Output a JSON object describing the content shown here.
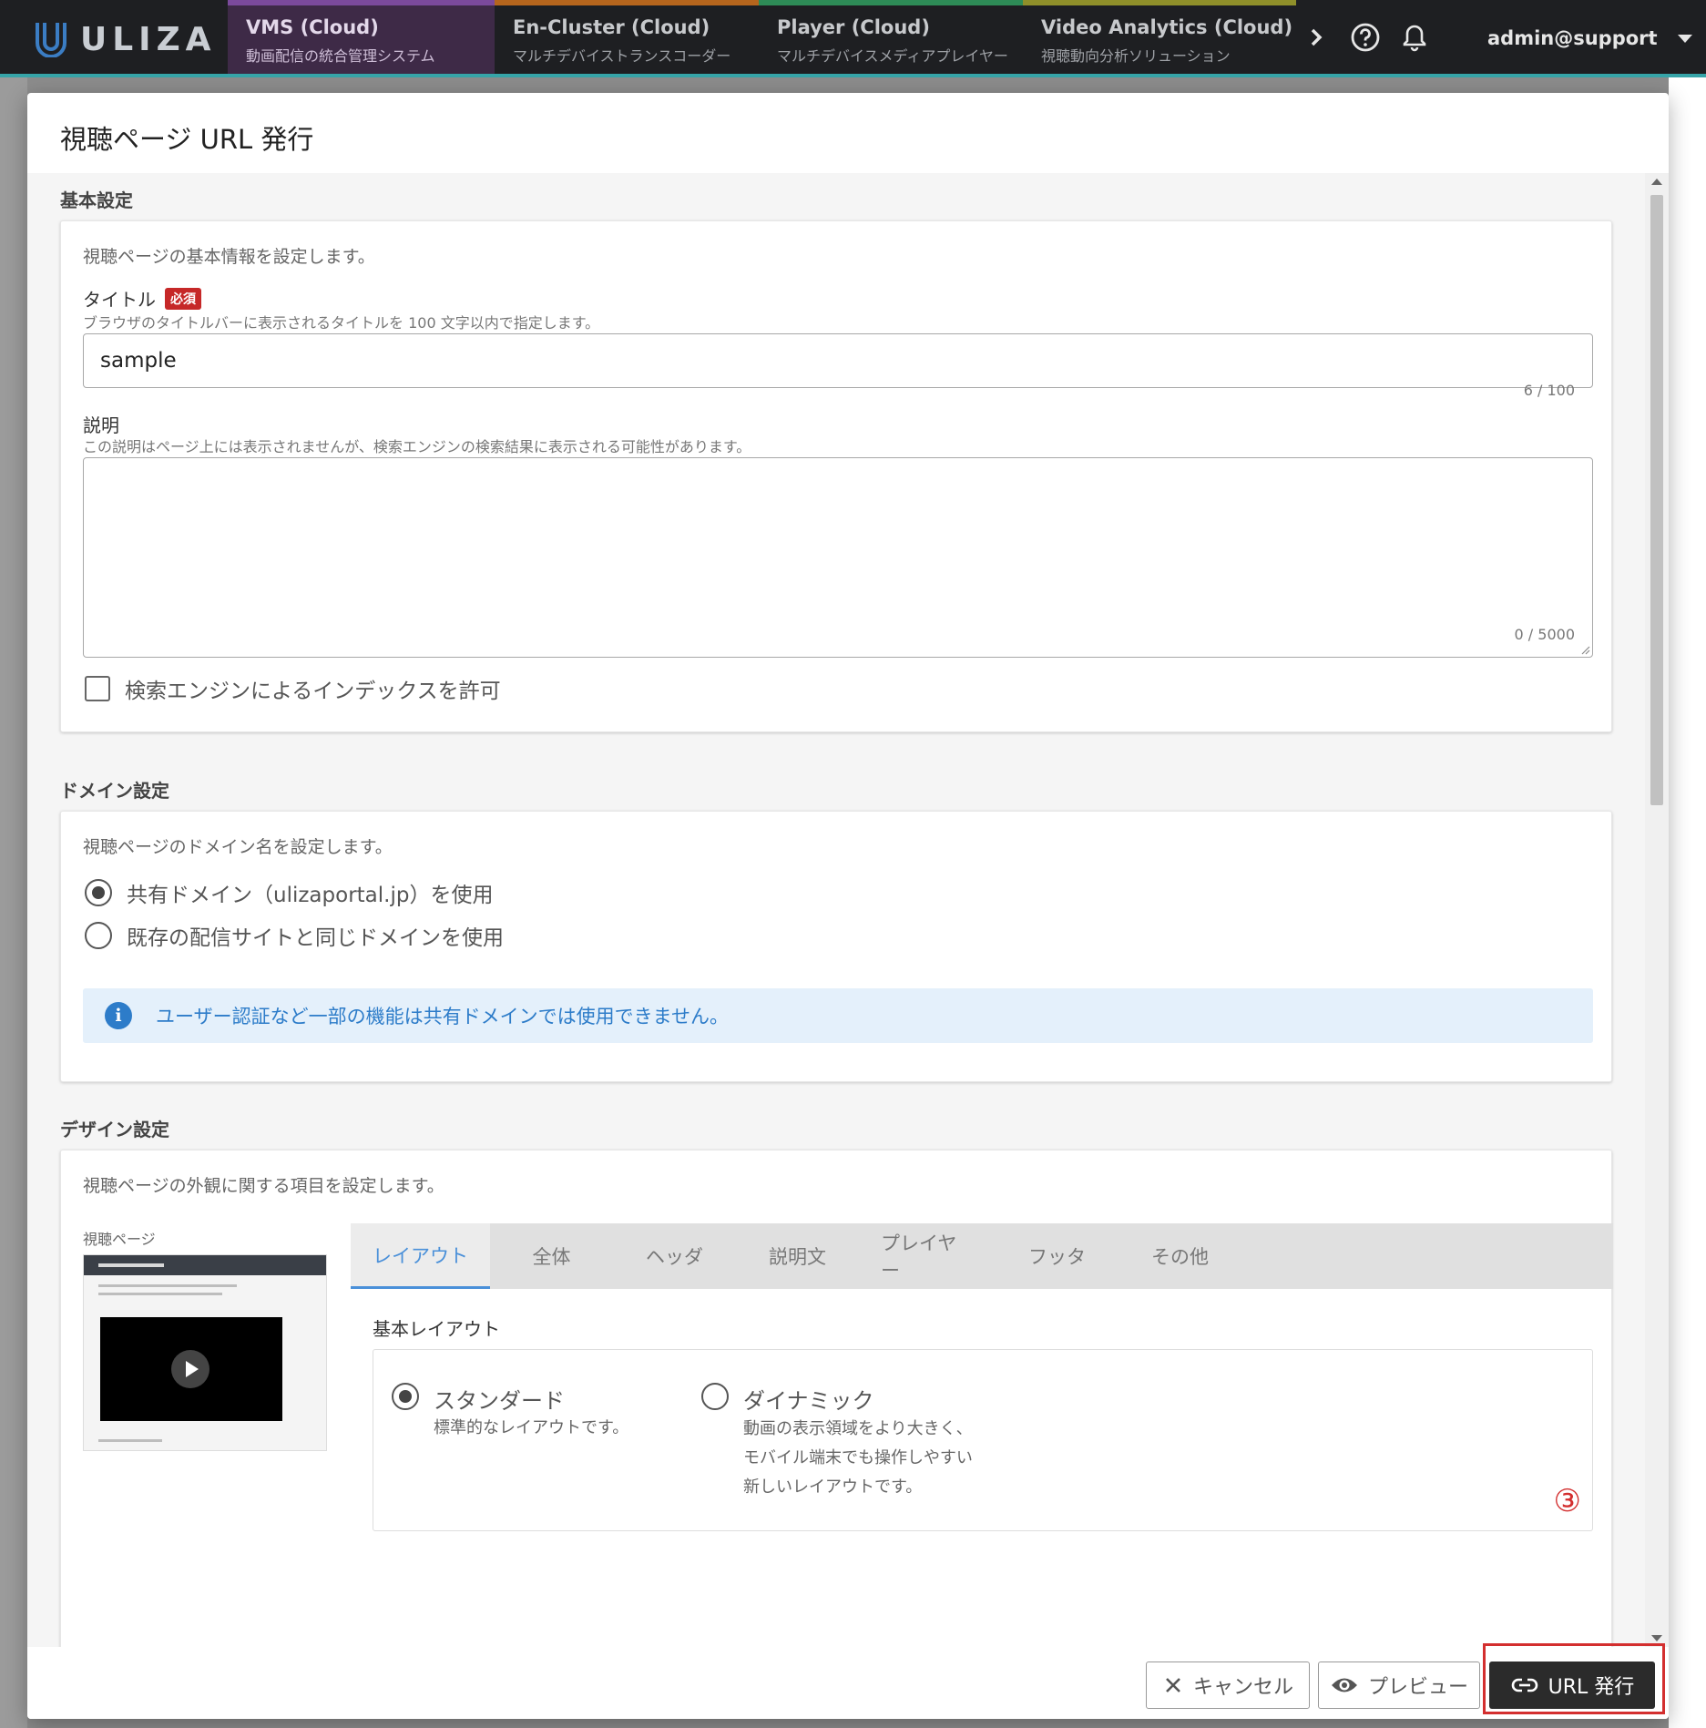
{
  "topbar": {
    "logo_text": "ULIZA",
    "products": [
      {
        "name": "VMS (Cloud)",
        "sub": "動画配信の統合管理システム",
        "accent": "#7b4a9c"
      },
      {
        "name": "En-Cluster (Cloud)",
        "sub": "マルチデバイストランスコーダー",
        "accent": "#b5651d"
      },
      {
        "name": "Player (Cloud)",
        "sub": "マルチデバイスメディアプレイヤー",
        "accent": "#2e8b57"
      },
      {
        "name": "Video Analytics (Cloud)",
        "sub": "視聴動向分析ソリューション",
        "accent": "#8f8f2a"
      }
    ],
    "user": "admin@support"
  },
  "dialog": {
    "title": "視聴ページ URL 発行",
    "basic": {
      "heading": "基本設定",
      "desc": "視聴ページの基本情報を設定します。",
      "title_label": "タイトル",
      "required_badge": "必須",
      "title_help": "ブラウザのタイトルバーに表示されるタイトルを 100 文字以内で指定します。",
      "title_value": "sample",
      "title_counter": "6 / 100",
      "desc_label": "説明",
      "desc_help": "この説明はページ上には表示されませんが、検索エンジンの検索結果に表示される可能性があります。",
      "desc_counter": "0 / 5000",
      "index_label": "検索エンジンによるインデックスを許可"
    },
    "domain": {
      "heading": "ドメイン設定",
      "desc": "視聴ページのドメイン名を設定します。",
      "option_shared": "共有ドメイン（ulizaportal.jp）を使用",
      "option_existing": "既存の配信サイトと同じドメインを使用",
      "info": "ユーザー認証など一部の機能は共有ドメインでは使用できません。"
    },
    "design": {
      "heading": "デザイン設定",
      "desc": "視聴ページの外観に関する項目を設定します。",
      "thumb_label": "視聴ページ",
      "tabs": [
        "レイアウト",
        "全体",
        "ヘッダ",
        "説明文",
        "プレイヤー",
        "フッタ",
        "その他"
      ],
      "layout_heading": "基本レイアウト",
      "standard_title": "スタンダード",
      "standard_desc": "標準的なレイアウトです。",
      "dynamic_title": "ダイナミック",
      "dynamic_desc": "動画の表示領域をより大きく、\nモバイル端末でも操作しやすい\n新しいレイアウトです。",
      "marker": "③"
    },
    "footer": {
      "cancel": "キャンセル",
      "preview": "プレビュー",
      "issue": "URL 発行"
    }
  }
}
